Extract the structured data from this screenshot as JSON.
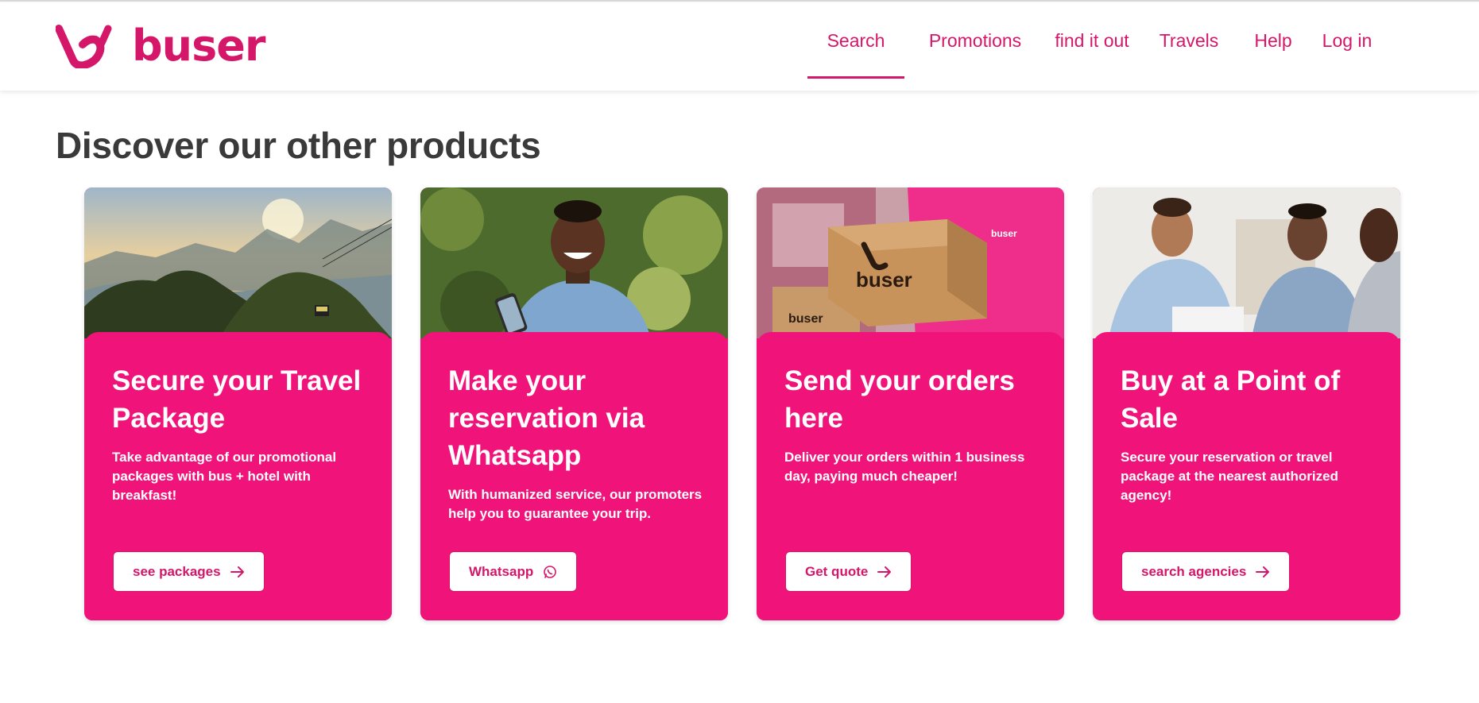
{
  "brand": {
    "name": "buser",
    "color": "#d5176a",
    "card_color": "#f0147a"
  },
  "nav": {
    "items": [
      {
        "label": "Search",
        "active": true
      },
      {
        "label": "Promotions",
        "active": false
      },
      {
        "label": "find it out",
        "active": false
      },
      {
        "label": "Travels",
        "active": false
      },
      {
        "label": "Help",
        "active": false
      },
      {
        "label": "Log in",
        "active": false
      }
    ]
  },
  "section": {
    "title": "Discover our other products"
  },
  "cards": [
    {
      "title": "Secure your Travel Package",
      "description": "Take advantage of our promotional packages with bus + hotel with breakfast!",
      "button": "see packages",
      "button_icon": "arrow-right-icon",
      "image": "rio-landscape-photo"
    },
    {
      "title": "Make your reservation via Whatsapp",
      "description": "With humanized service, our promoters help you to guarantee your trip.",
      "button": "Whatsapp",
      "button_icon": "whatsapp-icon",
      "image": "woman-with-phone-photo"
    },
    {
      "title": "Send your orders here",
      "description": "Deliver your orders within 1 business day, paying much cheaper!",
      "button": "Get quote",
      "button_icon": "arrow-right-icon",
      "image": "delivery-box-photo"
    },
    {
      "title": "Buy at a Point of Sale",
      "description": "Secure your reservation or travel package at the nearest authorized agency!",
      "button": "search agencies",
      "button_icon": "arrow-right-icon",
      "image": "agency-meeting-photo"
    }
  ]
}
